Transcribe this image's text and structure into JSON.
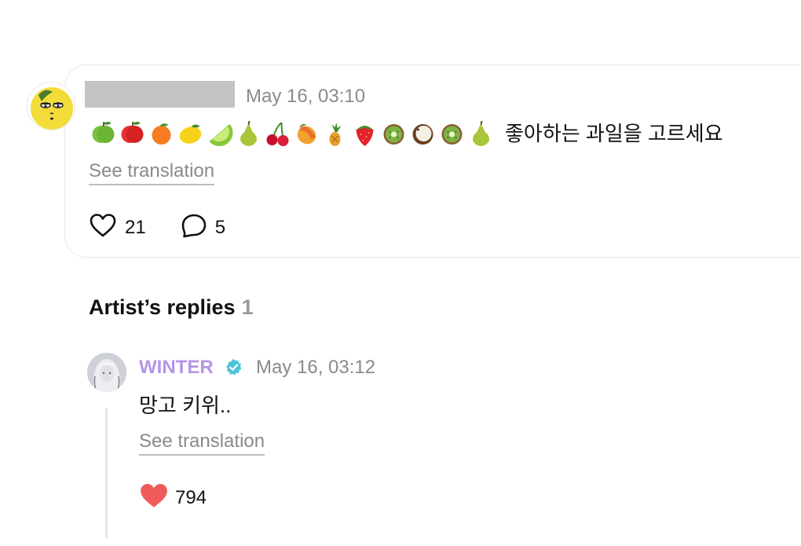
{
  "post": {
    "timestamp": "May 16, 03:10",
    "fruit_emojis": [
      "green-apple",
      "red-apple",
      "tangerine",
      "lemon",
      "lime",
      "pear",
      "cherries",
      "mango",
      "pineapple",
      "strawberry",
      "kiwi",
      "coconut",
      "kiwi",
      "pear"
    ],
    "text": "좋아하는 과일을 고르세요",
    "see_translation": "See translation",
    "likes": "21",
    "comments": "5"
  },
  "replies_section": {
    "title": "Artist’s replies",
    "count": "1"
  },
  "reply": {
    "author": "WINTER",
    "timestamp": "May 16, 03:12",
    "text": "망고 키위..",
    "see_translation": "See translation",
    "likes": "794"
  },
  "colors": {
    "artist_name": "#b694e6",
    "verified_badge": "#4cc3d9",
    "heart_filled": "#ef5b5b",
    "muted_text": "#8a8a8a"
  }
}
